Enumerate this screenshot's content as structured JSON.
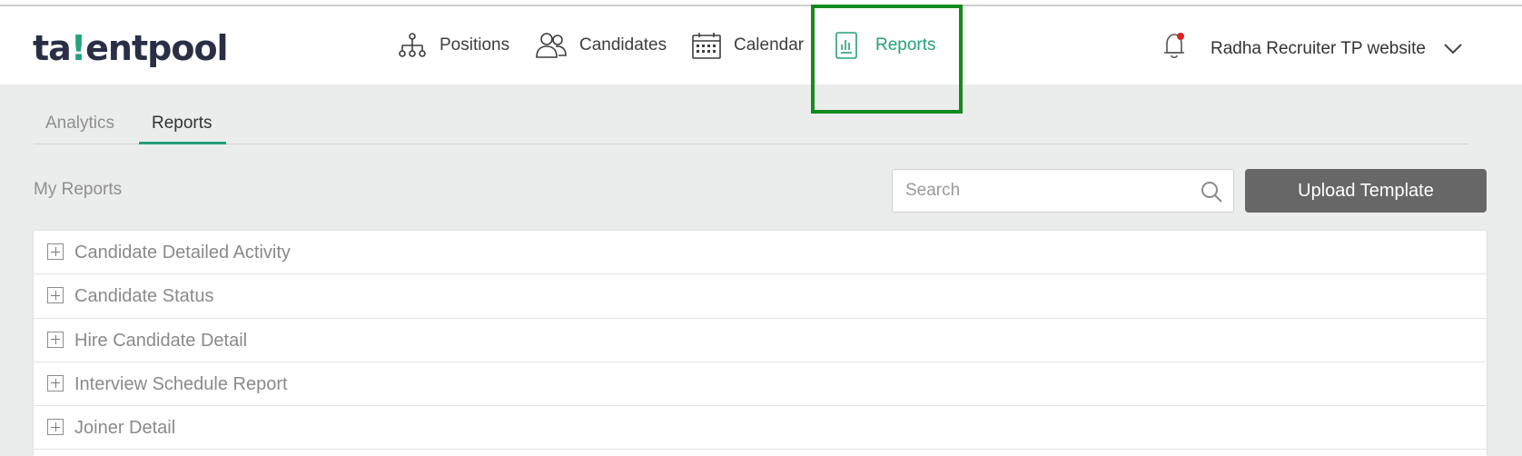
{
  "app": {
    "logo": {
      "part1": "ta",
      "part2": "!",
      "part3": "entpool"
    }
  },
  "nav": {
    "items": [
      {
        "label": "Positions",
        "icon": "org-chart-icon"
      },
      {
        "label": "Candidates",
        "icon": "users-icon"
      },
      {
        "label": "Calendar",
        "icon": "calendar-icon"
      },
      {
        "label": "Reports",
        "icon": "report-icon",
        "active": true
      }
    ]
  },
  "user": {
    "name": "Radha Recruiter TP website",
    "notification_dot_color": "#e02020"
  },
  "tabs": [
    {
      "label": "Analytics",
      "active": false
    },
    {
      "label": "Reports",
      "active": true
    }
  ],
  "section": {
    "title": "My Reports"
  },
  "search": {
    "placeholder": "Search",
    "value": ""
  },
  "actions": {
    "upload_label": "Upload Template"
  },
  "reports": [
    {
      "label": "Candidate Detailed Activity"
    },
    {
      "label": "Candidate Status"
    },
    {
      "label": "Hire Candidate Detail"
    },
    {
      "label": "Interview Schedule Report"
    },
    {
      "label": "Joiner Detail"
    }
  ],
  "colors": {
    "accent": "#24a07a",
    "highlight_box": "#158a1d",
    "button": "#676767"
  }
}
